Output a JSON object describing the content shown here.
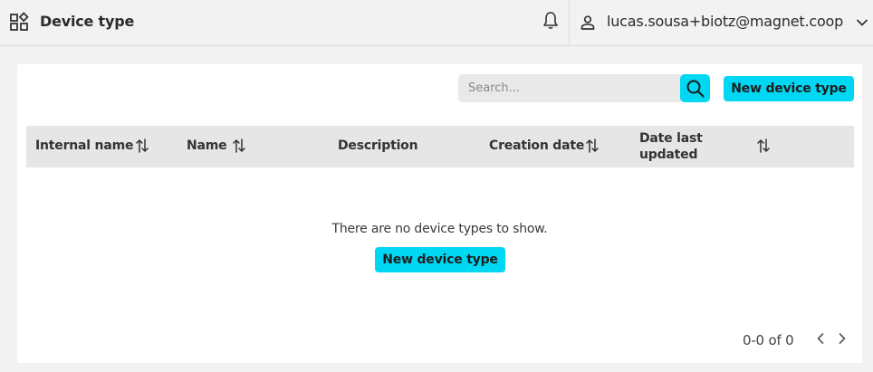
{
  "header": {
    "title": "Device type",
    "user_email": "lucas.sousa+biotz@magnet.coop",
    "icons": [
      "apps-icon",
      "bell-icon",
      "user-icon",
      "chevron-down-icon"
    ]
  },
  "toolbar": {
    "search_placeholder": "Search...",
    "new_button_label": "New device type"
  },
  "table": {
    "columns": [
      {
        "label": "Internal name",
        "sortable": true
      },
      {
        "label": "Name",
        "sortable": true
      },
      {
        "label": "Description",
        "sortable": false
      },
      {
        "label": "Creation date",
        "sortable": true
      },
      {
        "label": "Date last\nupdated",
        "sortable": true
      }
    ],
    "rows": []
  },
  "empty_state": {
    "message": "There are no device types to show.",
    "button_label": "New device type"
  },
  "pagination": {
    "range_text": "0-0 of 0"
  },
  "colors": {
    "accent": "#00d7f3",
    "background": "#f2f2f2",
    "header_row": "#e6e6e6"
  }
}
